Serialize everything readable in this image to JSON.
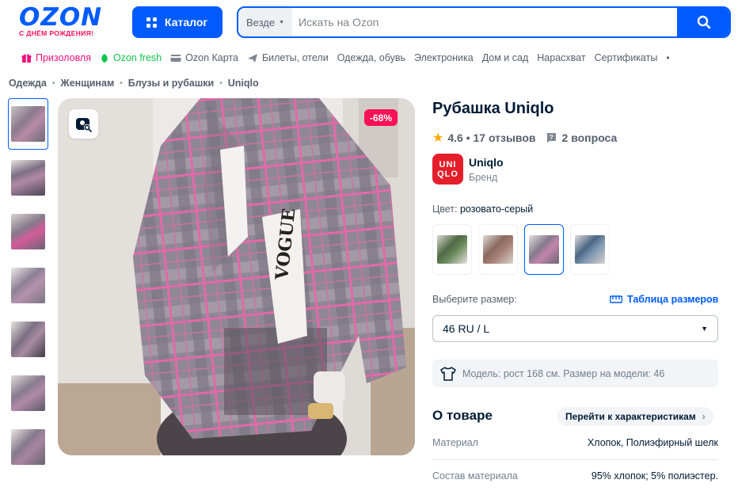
{
  "header": {
    "logo_text": "OZON",
    "logo_subtitle": "С ДНЁМ РОЖДЕНИЯ!",
    "catalog_label": "Каталог",
    "search_scope": "Везде",
    "search_placeholder": "Искать на Ozon",
    "brand_color": "#005bff",
    "accent_color": "#f91155"
  },
  "nav": {
    "items": [
      {
        "label": "Призоловля",
        "icon": "gift-icon"
      },
      {
        "label": "Ozon fresh",
        "icon": "leaf-icon"
      },
      {
        "label": "Ozon Карта",
        "icon": "card-icon"
      },
      {
        "label": "Билеты, отели",
        "icon": "plane-icon"
      },
      {
        "label": "Одежда, обувь"
      },
      {
        "label": "Электроника"
      },
      {
        "label": "Дом и сад"
      },
      {
        "label": "Нарасхват"
      },
      {
        "label": "Сертификаты"
      }
    ],
    "more": "•"
  },
  "breadcrumbs": [
    "Одежда",
    "Женщинам",
    "Блузы и рубашки",
    "Uniqlo"
  ],
  "gallery": {
    "discount_badge": "-68%",
    "thumb_count": 7
  },
  "product": {
    "title": "Рубашка Uniqlo",
    "rating": "4.6",
    "reviews": "17 отзывов",
    "questions": "2 вопроса",
    "brand_name": "Uniqlo",
    "brand_caption": "Бренд",
    "brand_logo_line1": "UNI",
    "brand_logo_line2": "QLO",
    "color_label": "Цвет:",
    "color_value": "розовато-серый",
    "size_label": "Выберите размер:",
    "size_table_link": "Таблица размеров",
    "size_selected": "46 RU / L",
    "model_info": "Модель: рост 168 см. Размер на модели: 46"
  },
  "about": {
    "title": "О товаре",
    "goto_button": "Перейти к характеристикам",
    "specs": [
      {
        "key": "Материал",
        "value": "Хлопок, Полиэфирный шелк"
      },
      {
        "key": "Состав материала",
        "value": "95% хлопок; 5% полиэстер."
      }
    ]
  }
}
